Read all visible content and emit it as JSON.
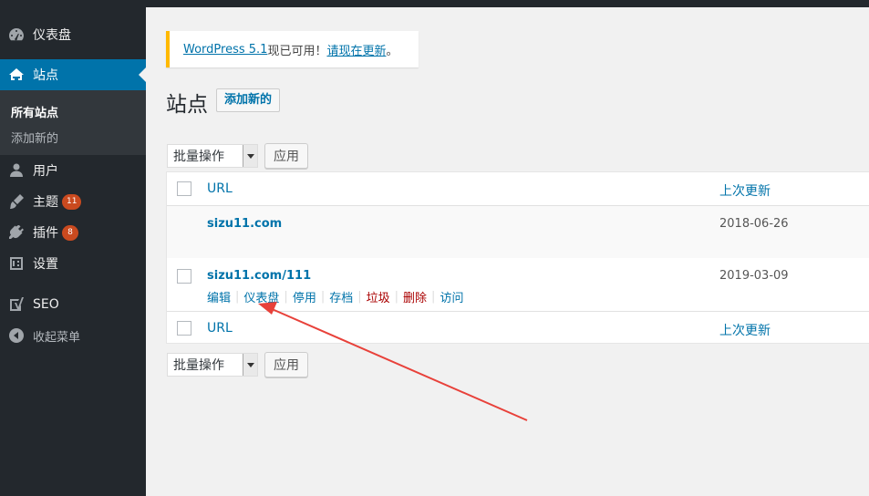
{
  "sidebar": {
    "items": [
      {
        "label": "仪表盘",
        "icon": "dashboard-icon",
        "badge": null
      },
      {
        "label": "站点",
        "icon": "sites-icon",
        "badge": null
      },
      {
        "label": "用户",
        "icon": "users-icon",
        "badge": null
      },
      {
        "label": "主题",
        "icon": "themes-icon",
        "badge": "11"
      },
      {
        "label": "插件",
        "icon": "plugins-icon",
        "badge": "8"
      },
      {
        "label": "设置",
        "icon": "settings-icon",
        "badge": null
      },
      {
        "label": "SEO",
        "icon": "seo-icon",
        "badge": null
      },
      {
        "label": "收起菜单",
        "icon": "collapse-icon",
        "badge": null
      }
    ],
    "submenu": [
      {
        "label": "所有站点"
      },
      {
        "label": "添加新的"
      }
    ]
  },
  "notice": {
    "link1": "WordPress 5.1",
    "text": "现已可用！",
    "link2": "请现在更新",
    "end": "。"
  },
  "page": {
    "title": "站点",
    "add_new": "添加新的"
  },
  "bulk": {
    "select_label": "批量操作",
    "apply_label": "应用"
  },
  "table": {
    "columns": [
      "URL",
      "上次更新"
    ],
    "rows": [
      {
        "url": "sizu11.com",
        "date": "2018-06-26"
      },
      {
        "url": "sizu11.com/111",
        "date": "2019-03-09"
      }
    ],
    "row_actions": [
      "编辑",
      "仪表盘",
      "停用",
      "存档",
      "垃圾",
      "删除",
      "访问"
    ]
  },
  "colors": {
    "accent": "#0073aa",
    "sidebar_bg": "#23282d",
    "badge": "#ca4a1f",
    "notice_border": "#ffb900",
    "annotation_arrow": "#e8413a"
  }
}
